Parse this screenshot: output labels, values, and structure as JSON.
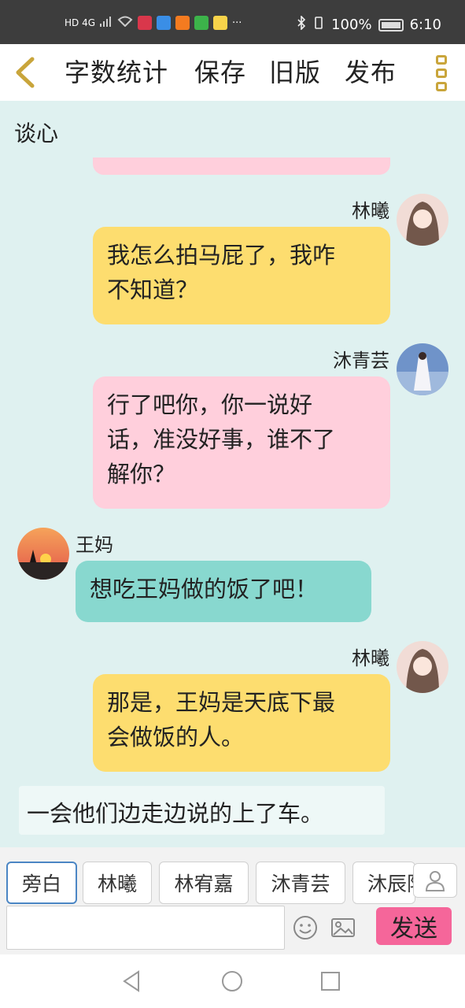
{
  "status_bar": {
    "left_text": "HD 4G",
    "app_icon_colors": [
      "#d9374b",
      "#3a8ee6",
      "#f47b20",
      "#3cb34a",
      "#f7d34a"
    ],
    "overflow": "···",
    "battery": "100%",
    "time": "6:10"
  },
  "toolbar": {
    "back_icon": "chevron-left-icon",
    "word_count": "字数统计",
    "save": "保存",
    "old_version": "旧版",
    "publish": "发布",
    "more_icon": "more-vertical-icon"
  },
  "chat": {
    "title": "谈心",
    "messages": [
      {
        "speaker": "林曦",
        "side": "right",
        "color": "yellow",
        "lines": [
          "我怎么拍马屁了，我咋",
          "不知道？"
        ]
      },
      {
        "speaker": "沐青芸",
        "side": "right",
        "color": "pink",
        "lines": [
          "行了吧你，你一说好",
          "话，准没好事，谁不了",
          "解你？"
        ]
      },
      {
        "speaker": "王妈",
        "side": "left",
        "color": "teal",
        "lines": [
          "想吃王妈做的饭了吧！"
        ]
      },
      {
        "speaker": "林曦",
        "side": "right",
        "color": "yellow",
        "lines": [
          "那是，王妈是天底下最",
          "会做饭的人。"
        ]
      }
    ],
    "narration": "一会他们边走边说的上了车。"
  },
  "roles": [
    "旁白",
    "林曦",
    "林宥嘉",
    "沐青芸",
    "沐辰阳"
  ],
  "composer": {
    "input_value": "",
    "send_label": "发送",
    "emoji_icon": "smiley-icon",
    "image_icon": "image-icon",
    "person_icon": "person-icon"
  },
  "colors": {
    "chat_bg": "#dff1f0",
    "bubble_yellow": "#fddd6f",
    "bubble_pink": "#ffcfdc",
    "bubble_teal": "#88d8cf",
    "send_btn": "#f5669a",
    "accent_gold": "#c9a53b"
  }
}
